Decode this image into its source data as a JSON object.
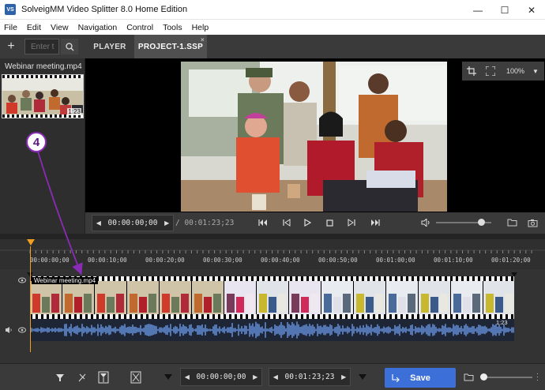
{
  "window": {
    "title": "SolveigMM Video Splitter 8.0 Home Edition",
    "icon_text": "VS",
    "minimize_label": "—",
    "maximize_label": "☐",
    "close_label": "✕"
  },
  "menu": [
    "File",
    "Edit",
    "View",
    "Navigation",
    "Control",
    "Tools",
    "Help"
  ],
  "toolbar": {
    "add_label": "+",
    "search_placeholder": "Enter t"
  },
  "tabs": [
    {
      "label": "PLAYER",
      "active": false
    },
    {
      "label": "PROJECT-1.SSP",
      "active": true,
      "close": "×"
    }
  ],
  "media": {
    "file_name": "Webinar meeting.mp4",
    "duration": "1:23"
  },
  "player": {
    "zoom": "100%",
    "zoom_caret": "▼",
    "current_time": "00:00:00;00",
    "total_time": "/ 00:01:23;23"
  },
  "timeline": {
    "ticks": [
      "00:00:00;00",
      "00:00:10;00",
      "00:00:20;00",
      "00:00:30;00",
      "00:00:40;00",
      "00:00:50;00",
      "00:01:00;00",
      "00:01:10;00",
      "00:01:20;00"
    ],
    "track_name": "Webinar meeting.mp4",
    "track_duration": "1:23"
  },
  "annotation": {
    "label": "4",
    "color": "#8a2bb5"
  },
  "bottom": {
    "start_time": "00:00:00;00",
    "end_time": "00:01:23;23",
    "save_label": "Save",
    "save_color": "#3d6fd9"
  }
}
